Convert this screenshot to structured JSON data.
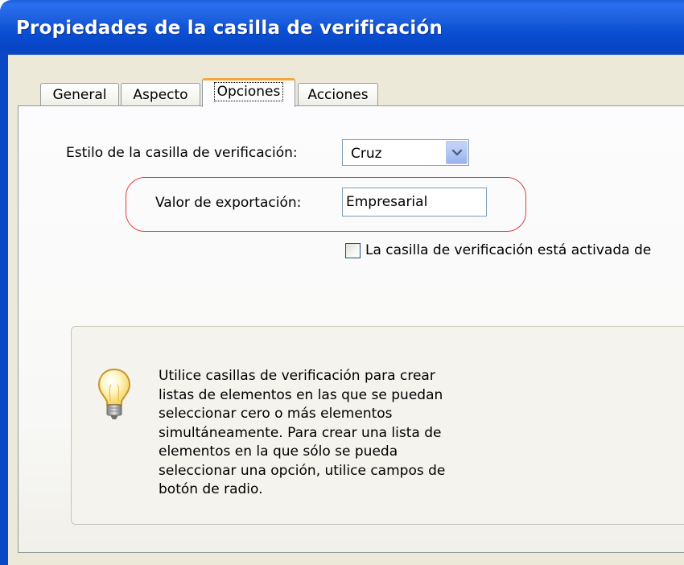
{
  "window": {
    "title": "Propiedades de la casilla de verificación"
  },
  "tabs": [
    {
      "label": "General",
      "active": false
    },
    {
      "label": "Aspecto",
      "active": false
    },
    {
      "label": "Opciones",
      "active": true
    },
    {
      "label": "Acciones",
      "active": false
    }
  ],
  "options": {
    "style_label": "Estilo de la casilla de verificación:",
    "style_value": "Cruz",
    "export_label": "Valor de exportación:",
    "export_value": "Empresarial",
    "default_checkbox_label": "La casilla de verificación está activada de",
    "default_checked": false
  },
  "info": {
    "icon": "lightbulb-icon",
    "lines": [
      "Utilice casillas de verificación para crear",
      "listas de elementos en las que se puedan",
      "seleccionar cero o más elementos",
      "simultáneamente. Para crear una lista de",
      "elementos en la que sólo se pueda",
      "seleccionar una opción, utilice campos de",
      "botón de radio."
    ]
  },
  "colors": {
    "titlebar": "#0a4fd2",
    "dialog_bg": "#ece9d8",
    "active_tab_accent": "#f7a541",
    "highlight_ring": "#e53b3b",
    "field_border": "#7f9db9"
  }
}
